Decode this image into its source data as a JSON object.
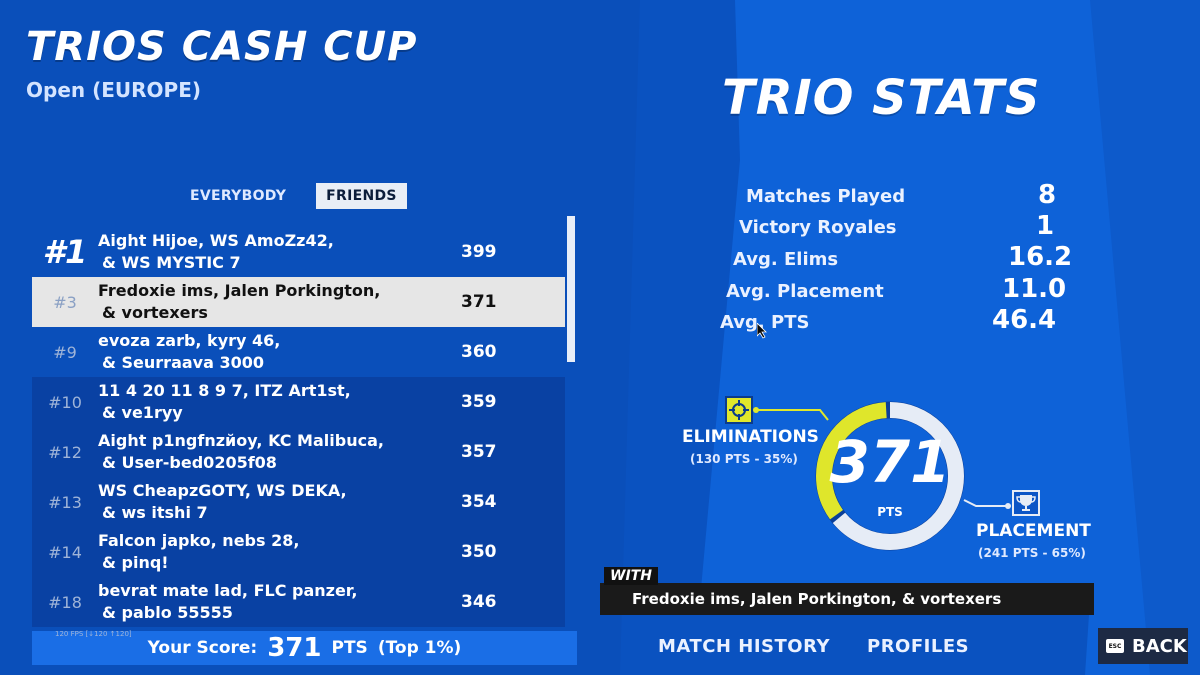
{
  "header": {
    "title": "TRIOS CASH CUP",
    "subtitle": "Open (EUROPE)"
  },
  "tabs": [
    {
      "label": "EVERYBODY",
      "active": false
    },
    {
      "label": "FRIENDS",
      "active": true
    }
  ],
  "leaderboard": [
    {
      "rank": "#1",
      "line1": "Aight Hijoe, WS AmoZz42,",
      "line2": "& WS MYSTIC 7",
      "score": "399"
    },
    {
      "rank": "#3",
      "line1": "Fredoxie ims, Jalen Porkington,",
      "line2": "& vortexers",
      "score": "371",
      "highlighted": true
    },
    {
      "rank": "#9",
      "line1": "evoza zarb, kyry 46,",
      "line2": "& Seurraava 3000",
      "score": "360"
    },
    {
      "rank": "#10",
      "line1": "11 4 20 11 8 9 7, ITZ Art1st,",
      "line2": "& ve1ryy",
      "score": "359"
    },
    {
      "rank": "#12",
      "line1": "Aight p1ngfnzйoy, KC Malibuca,",
      "line2": "& User-bed0205f08",
      "score": "357"
    },
    {
      "rank": "#13",
      "line1": "WS CheapzGOTY, WS DEKA,",
      "line2": "& ws itshi 7",
      "score": "354"
    },
    {
      "rank": "#14",
      "line1": "Falcon japko, nebs 28,",
      "line2": "& pinq!",
      "score": "350"
    },
    {
      "rank": "#18",
      "line1": "bevrat mate lad, FLC panzer,",
      "line2": "& pablo 55555",
      "score": "346"
    }
  ],
  "fps": "120 FPS [↓120 ↑120]",
  "your_score": {
    "label": "Your Score:",
    "value": "371",
    "unit": "PTS",
    "top": "(Top 1%)"
  },
  "trio_stats": {
    "title": "TRIO STATS",
    "items": [
      {
        "label": "Matches Played",
        "value": "8"
      },
      {
        "label": "Victory Royales",
        "value": "1"
      },
      {
        "label": "Avg. Elims",
        "value": "16.2"
      },
      {
        "label": "Avg. Placement",
        "value": "11.0"
      },
      {
        "label": "Avg. PTS",
        "value": "46.4"
      }
    ]
  },
  "donut": {
    "total": "371",
    "unit": "PTS",
    "elim_fraction": 0.35,
    "elim_color": "#dfe62b",
    "placement_color": "#e6ecf6",
    "eliminations": {
      "label": "ELIMINATIONS",
      "detail": "(130 PTS - 35%)",
      "icon": "crosshair-icon"
    },
    "placement": {
      "label": "PLACEMENT",
      "detail": "(241 PTS - 65%)",
      "icon": "trophy-icon"
    }
  },
  "with": {
    "tag": "WITH",
    "names": "Fredoxie ims, Jalen Porkington, & vortexers"
  },
  "bottom_nav": {
    "match_history": "MATCH HISTORY",
    "profiles": "PROFILES",
    "back": "BACK",
    "esc": "ESC"
  }
}
